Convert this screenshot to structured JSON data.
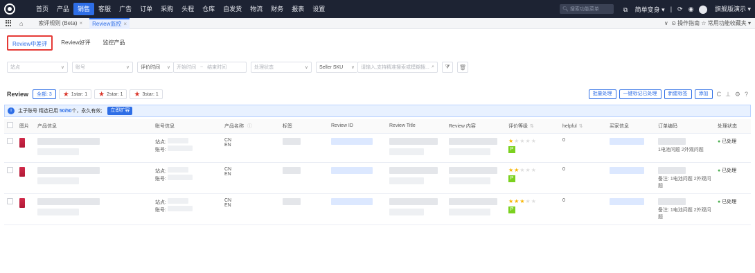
{
  "topnav": {
    "items": [
      "首页",
      "产品",
      "销售",
      "客服",
      "广告",
      "订单",
      "采购",
      "头程",
      "仓库",
      "自发货",
      "物流",
      "财务",
      "报表",
      "设置"
    ],
    "active_index": 2,
    "search_placeholder": "搜索功能菜单",
    "right": {
      "switch": "简单变身",
      "user": "旗舰版演示"
    }
  },
  "tabs": {
    "items": [
      {
        "label": "索评规则 (Beta)",
        "active": false
      },
      {
        "label": "Review监控",
        "active": true
      }
    ],
    "right": "操作指南 ☆ 常用功能收藏夹"
  },
  "subtabs": [
    "Review中差评",
    "Review好评",
    "监控产品"
  ],
  "filters": {
    "site": "站点",
    "account": "账号",
    "review_time": "评价时间",
    "start_time": "开始时间",
    "tilde": "~",
    "end_time": "结束时间",
    "status": "处理状态",
    "seller_sku": "Seller SKU",
    "search_placeholder": "请输入,支持精准搜索或模糊搜..."
  },
  "toolbar": {
    "title": "Review",
    "star_tabs": [
      {
        "label": "全部: 3",
        "active": true,
        "star": false
      },
      {
        "label": "1star: 1",
        "active": false,
        "star": true
      },
      {
        "label": "2star: 1",
        "active": false,
        "star": true
      },
      {
        "label": "3star: 1",
        "active": false,
        "star": true
      }
    ],
    "buttons": [
      "批量处理",
      "一键标记已处理",
      "新建标签",
      "添加"
    ]
  },
  "notice": {
    "text_prefix": "主子账号 精选已用",
    "count": "50/50",
    "text_suffix": "个，永久有效;",
    "expand": "立即扩容"
  },
  "columns": [
    "图片",
    "产品信息",
    "账号信息",
    "产品名称",
    "标签",
    "Review ID",
    "Review Title",
    "Review 内容",
    "评价等级",
    "helpful",
    "买家信息",
    "订单编码",
    "处理状态"
  ],
  "rows": [
    {
      "account1": "站点:",
      "account2": "账号:",
      "name1": "CN",
      "name2": "EN",
      "stars": 1,
      "badge": "P",
      "helpful": "0",
      "order": "",
      "status": "已处理"
    },
    {
      "account1": "站点:",
      "account2": "账号:",
      "name1": "CN",
      "name2": "EN",
      "stars": 2,
      "badge": "P",
      "helpful": "0",
      "order": "备注: 1电池问题 2外观问题",
      "status": "已处理"
    },
    {
      "account1": "站点:",
      "account2": "账号:",
      "name1": "CN",
      "name2": "EN",
      "stars": 3,
      "badge": "P",
      "helpful": "0",
      "order": "备注: 1电池问题 2外观问题",
      "status": "已处理"
    }
  ],
  "row1_order": "1电池问题 2外观问题"
}
